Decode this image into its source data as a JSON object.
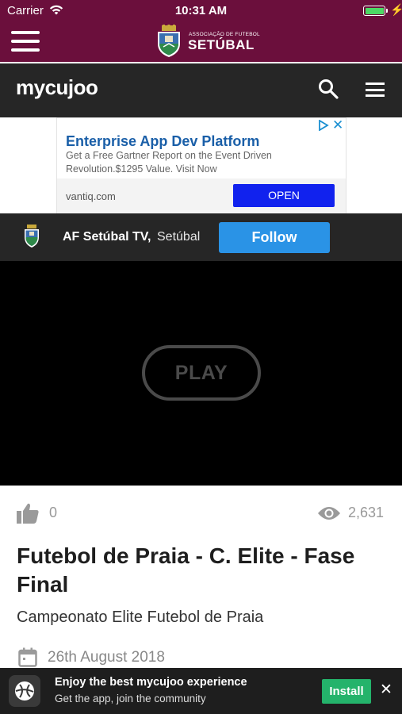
{
  "status_bar": {
    "carrier": "Carrier",
    "time": "10:31 AM",
    "battery_level": 1.0,
    "icons": [
      "wifi-icon",
      "battery-icon",
      "charging-icon"
    ]
  },
  "app_header": {
    "menu_icon": "hamburger-icon",
    "brand_small": "ASSOCIAÇÃO DE FUTEBOL",
    "brand_big": "SETÚBAL",
    "background": "#6b0f3c"
  },
  "mycujoo_bar": {
    "logo": "mycujoo",
    "search_icon": "search-icon",
    "menu_icon": "hamburger-icon"
  },
  "ad": {
    "title": "Enterprise App Dev Platform",
    "description": "Get a Free Gartner Report on the Event Driven Revolution.$1295 Value. Visit Now",
    "domain": "vantiq.com",
    "cta": "OPEN",
    "close": "✕",
    "cta_color": "#1122ee"
  },
  "channel": {
    "name": "AF Setúbal TV,",
    "location": "Setúbal",
    "follow_label": "Follow",
    "follow_color": "#2a93e6"
  },
  "player": {
    "play_label": "PLAY"
  },
  "stats": {
    "likes": "0",
    "views": "2,631"
  },
  "event": {
    "title": "Futebol de Praia - C. Elite - Fase Final",
    "subtitle": "Campeonato Elite Futebol de Praia",
    "date": "26th August 2018"
  },
  "install_banner": {
    "headline": "Enjoy the best mycujoo experience",
    "subline": "Get the app, join the community",
    "install_label": "Install",
    "close": "✕",
    "install_color": "#24b36b"
  }
}
